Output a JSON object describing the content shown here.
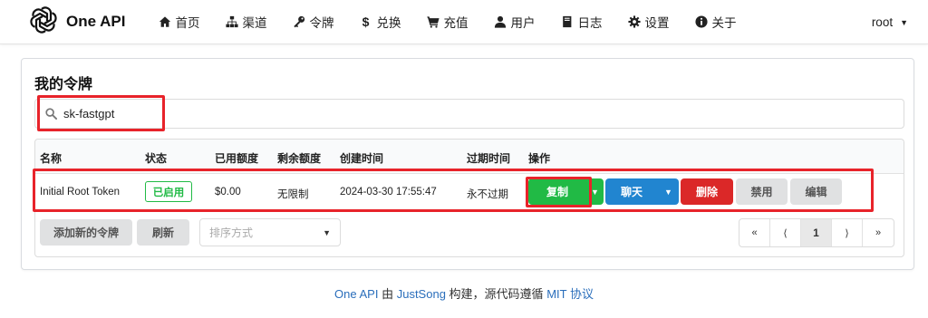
{
  "nav": {
    "brand": "One API",
    "items": [
      {
        "label": "首页",
        "icon": "home-icon"
      },
      {
        "label": "渠道",
        "icon": "sitemap-icon"
      },
      {
        "label": "令牌",
        "icon": "key-icon"
      },
      {
        "label": "兑换",
        "icon": "dollar-icon"
      },
      {
        "label": "充值",
        "icon": "cart-icon"
      },
      {
        "label": "用户",
        "icon": "user-icon"
      },
      {
        "label": "日志",
        "icon": "book-icon"
      },
      {
        "label": "设置",
        "icon": "gear-icon"
      },
      {
        "label": "关于",
        "icon": "info-icon"
      }
    ],
    "user": "root"
  },
  "page": {
    "title": "我的令牌",
    "search_value": "sk-fastgpt"
  },
  "table": {
    "headers": [
      "名称",
      "状态",
      "已用额度",
      "剩余额度",
      "创建时间",
      "过期时间",
      "操作"
    ],
    "rows": [
      {
        "name": "Initial Root Token",
        "status": "已启用",
        "used": "$0.00",
        "remaining": "无限制",
        "created": "2024-03-30 17:55:47",
        "expires": "永不过期"
      }
    ],
    "actions": {
      "copy": "复制",
      "chat": "聊天",
      "delete": "删除",
      "disable": "禁用",
      "edit": "编辑"
    }
  },
  "footer_controls": {
    "add": "添加新的令牌",
    "refresh": "刷新",
    "sort_placeholder": "排序方式",
    "pager": [
      "«",
      "⟨",
      "1",
      "⟩",
      "»"
    ]
  },
  "footer": {
    "brand": "One API",
    "by": "由",
    "author": "JustSong",
    "built": "构建，源代码遵循",
    "license": "MIT 协议"
  },
  "colors": {
    "green": "#21ba45",
    "blue": "#2185d0",
    "red": "#db2828",
    "highlight": "#e8232a",
    "link": "#2a6ebb"
  }
}
